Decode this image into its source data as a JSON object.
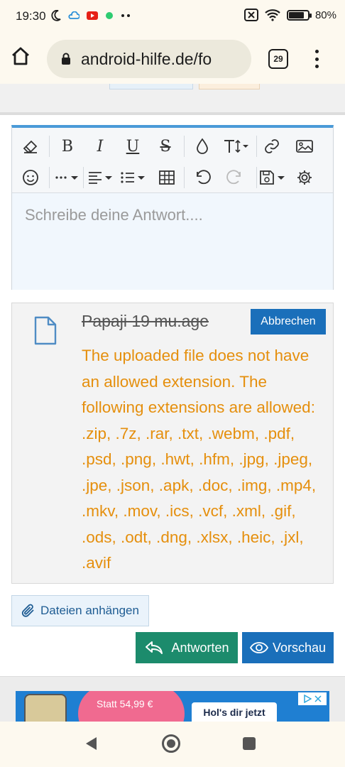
{
  "status_bar": {
    "time": "19:30",
    "battery": "80%",
    "battery_level": 0.8
  },
  "browser": {
    "url": "android-hilfe.de/fo",
    "tab_count": "29"
  },
  "editor": {
    "placeholder": "Schreibe deine Antwort...."
  },
  "attachment": {
    "file_name": "Papaji 19 mu.age",
    "cancel_label": "Abbrechen",
    "error_message": "The uploaded file does not have an allowed extension. The following extensions are allowed: .zip, .7z, .rar, .txt, .webm, .pdf, .psd, .png, .hwt, .hfm, .jpg, .jpeg, .jpe, .json, .apk, .doc, .img, .mp4, .mkv, .mov, .ics, .vcf, .xml, .gif, .ods, .odt, .dng, .xlsx, .heic, .jxl, .avif"
  },
  "actions": {
    "attach_label": "Dateien anhängen",
    "reply_label": "Antworten",
    "preview_label": "Vorschau"
  },
  "ad": {
    "price_text": "Statt 54,99 €",
    "cta_text": "Hol's dir jetzt"
  },
  "colors": {
    "primary_blue": "#1a6fba",
    "reply_green": "#1c8b6c",
    "error_orange": "#e58f0d",
    "editor_accent": "#4a9ad8"
  }
}
